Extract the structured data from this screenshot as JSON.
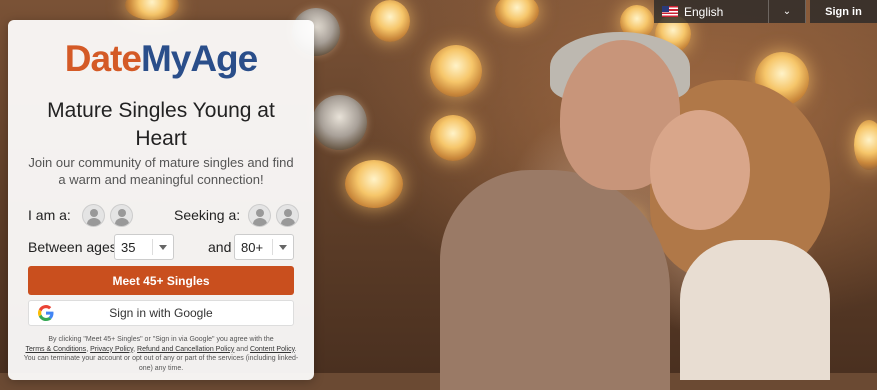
{
  "brand": {
    "logo_date": "Date",
    "logo_rest": "MyAge"
  },
  "topbar": {
    "language": "English",
    "signin_label": "Sign in"
  },
  "form": {
    "headline": "Mature Singles Young at Heart",
    "subheadline": "Join our community of mature singles and find a warm and meaningful connection!",
    "i_am_label": "I am a:",
    "seeking_label": "Seeking a:",
    "between_ages_label": "Between ages:",
    "and_label": "and",
    "min_age": "35",
    "max_age": "80+",
    "cta_label": "Meet 45+ Singles",
    "google_label": "Sign in with Google"
  },
  "legal": {
    "text1": "By clicking \"Meet 45+ Singles\" or \"Sign in via Google\" you agree with the",
    "terms": "Terms & Conditions",
    "comma1": ",",
    "privacy": "Privacy Policy",
    "comma2": ",",
    "refund": "Refund and Cancellation Policy",
    "and": "and",
    "content": "Content Policy",
    "period": ".",
    "text2": "You can terminate your account or opt out of any or part of the services (including linked-one) any time."
  },
  "colors": {
    "brand_orange": "#d45a26",
    "brand_blue": "#2a4e8a",
    "cta": "#c94f1e"
  },
  "icons": [
    "us-flag-icon",
    "chevron-down-icon",
    "male-avatar-icon",
    "female-avatar-icon",
    "google-g-icon"
  ]
}
